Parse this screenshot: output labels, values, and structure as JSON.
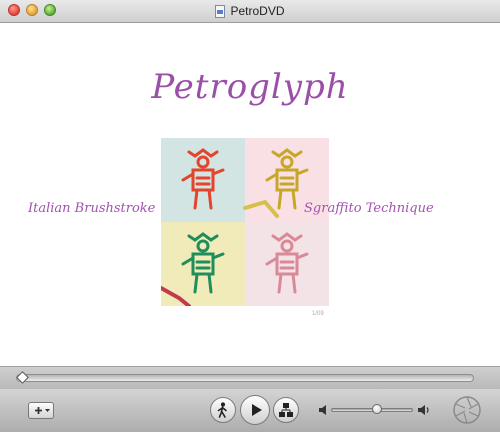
{
  "window": {
    "title": "PetroDVD"
  },
  "disc_menu": {
    "title": "Petroglyph",
    "left_option": "Italian Brushstroke",
    "right_option": "Sgraffito Technique",
    "artwork_number": "1/09"
  },
  "toolbar": {
    "add_icon": "plus-icon",
    "viewer_icon": "walking-figure-icon",
    "play_icon": "play-icon",
    "menu_icon": "disc-menu-icon",
    "volume_low_icon": "volume-low-icon",
    "volume_high_icon": "volume-high-icon",
    "volume_level": 0.56,
    "shutter_icon": "aperture-icon"
  },
  "colors": {
    "title_accent": "#9a4fa8",
    "menu_text": "#a451b2"
  }
}
